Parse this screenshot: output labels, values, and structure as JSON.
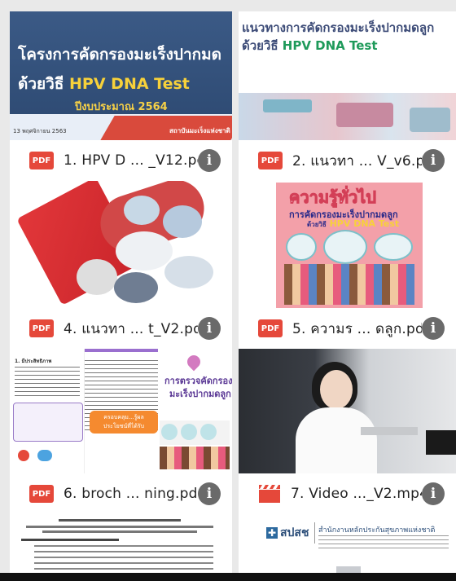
{
  "files": [
    {
      "name": "1. HPV D ... _V12.pdf",
      "type_badge": "PDF"
    },
    {
      "name": "2. แนวทา ... V_v6.pdf",
      "type_badge": "PDF"
    },
    {
      "name": "4. แนวทา ... t_V2.pdf",
      "type_badge": "PDF"
    },
    {
      "name": "5. ความร ... ดลูก.pdf",
      "type_badge": "PDF"
    },
    {
      "name": "6. broch ... ning.pdf",
      "type_badge": "PDF"
    },
    {
      "name": "7. Video ..._V2.mp4",
      "type_badge": "VIDEO"
    }
  ],
  "info_glyph": "i",
  "thumbs": {
    "t1": {
      "line1": "โครงการคัดกรองมะเร็งปากมด",
      "line2_prefix": "ด้วยวิธี",
      "line2_highlight": "HPV DNA Test",
      "line3": "ปีงบประมาณ 2564",
      "date": "13 พฤศจิกายน 2563",
      "org": "สถาบันมะเร็งแห่งชาติ"
    },
    "t2": {
      "line1": "แนวทางการคัดกรองมะเร็งปากมดลูก",
      "line2_prefix": "ด้วยวิธี",
      "line2_highlight": "HPV DNA Test"
    },
    "t4": {
      "title": "ความรู้ทั่วไป",
      "sub1": "การคัดกรองมะเร็งปากมดลูก",
      "sub2_prefix": "ด้วยวิธี",
      "sub2_highlight": "HPV DNA Test"
    },
    "t5": {
      "title1": "การตรวจคัดกรอง",
      "title2": "มะเร็งปากมดลูก",
      "heading": "1. มีประสิทธิภาพ",
      "box": "ครอบคลุม...รู้ผล ประโยชน์ที่ได้รับ"
    },
    "t8": {
      "org_short": "สปสช",
      "org_name": "สำนักงานหลักประกันสุขภาพแห่งชาติ"
    }
  },
  "colors": {
    "pdf_red": "#e5483a",
    "info_gray": "#6a6a6a"
  }
}
